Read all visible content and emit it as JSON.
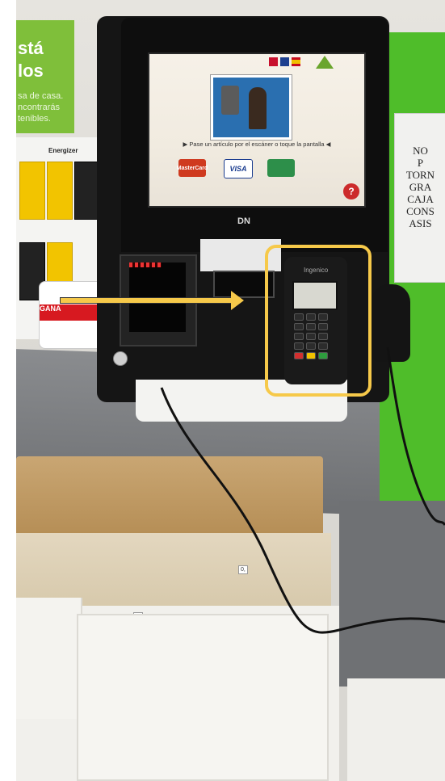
{
  "poster": {
    "line1": "stá",
    "line2": "los",
    "line3": "sa de casa.",
    "line4": "ncontrarás",
    "line5": "tenibles."
  },
  "notice": {
    "lines": [
      "NO",
      "P",
      "TORN",
      "GRA",
      "CAJA",
      "CONS",
      "ASIS"
    ]
  },
  "battery_brand": "Energizer",
  "tag_band": "GANA",
  "kiosk": {
    "screen_prompt": "Pase un artículo por el escáner o toque la pantalla",
    "cards": [
      "MasterCard",
      "VISA",
      ""
    ],
    "help_label": "?",
    "brand_mark": "DN"
  },
  "reader": {
    "brand": "Ingenico"
  },
  "price_labels": [
    "0,",
    "2,"
  ],
  "colors": {
    "highlight": "#f6c94a",
    "wall_green": "#4fbd2a",
    "kiosk_body": "#151515"
  }
}
